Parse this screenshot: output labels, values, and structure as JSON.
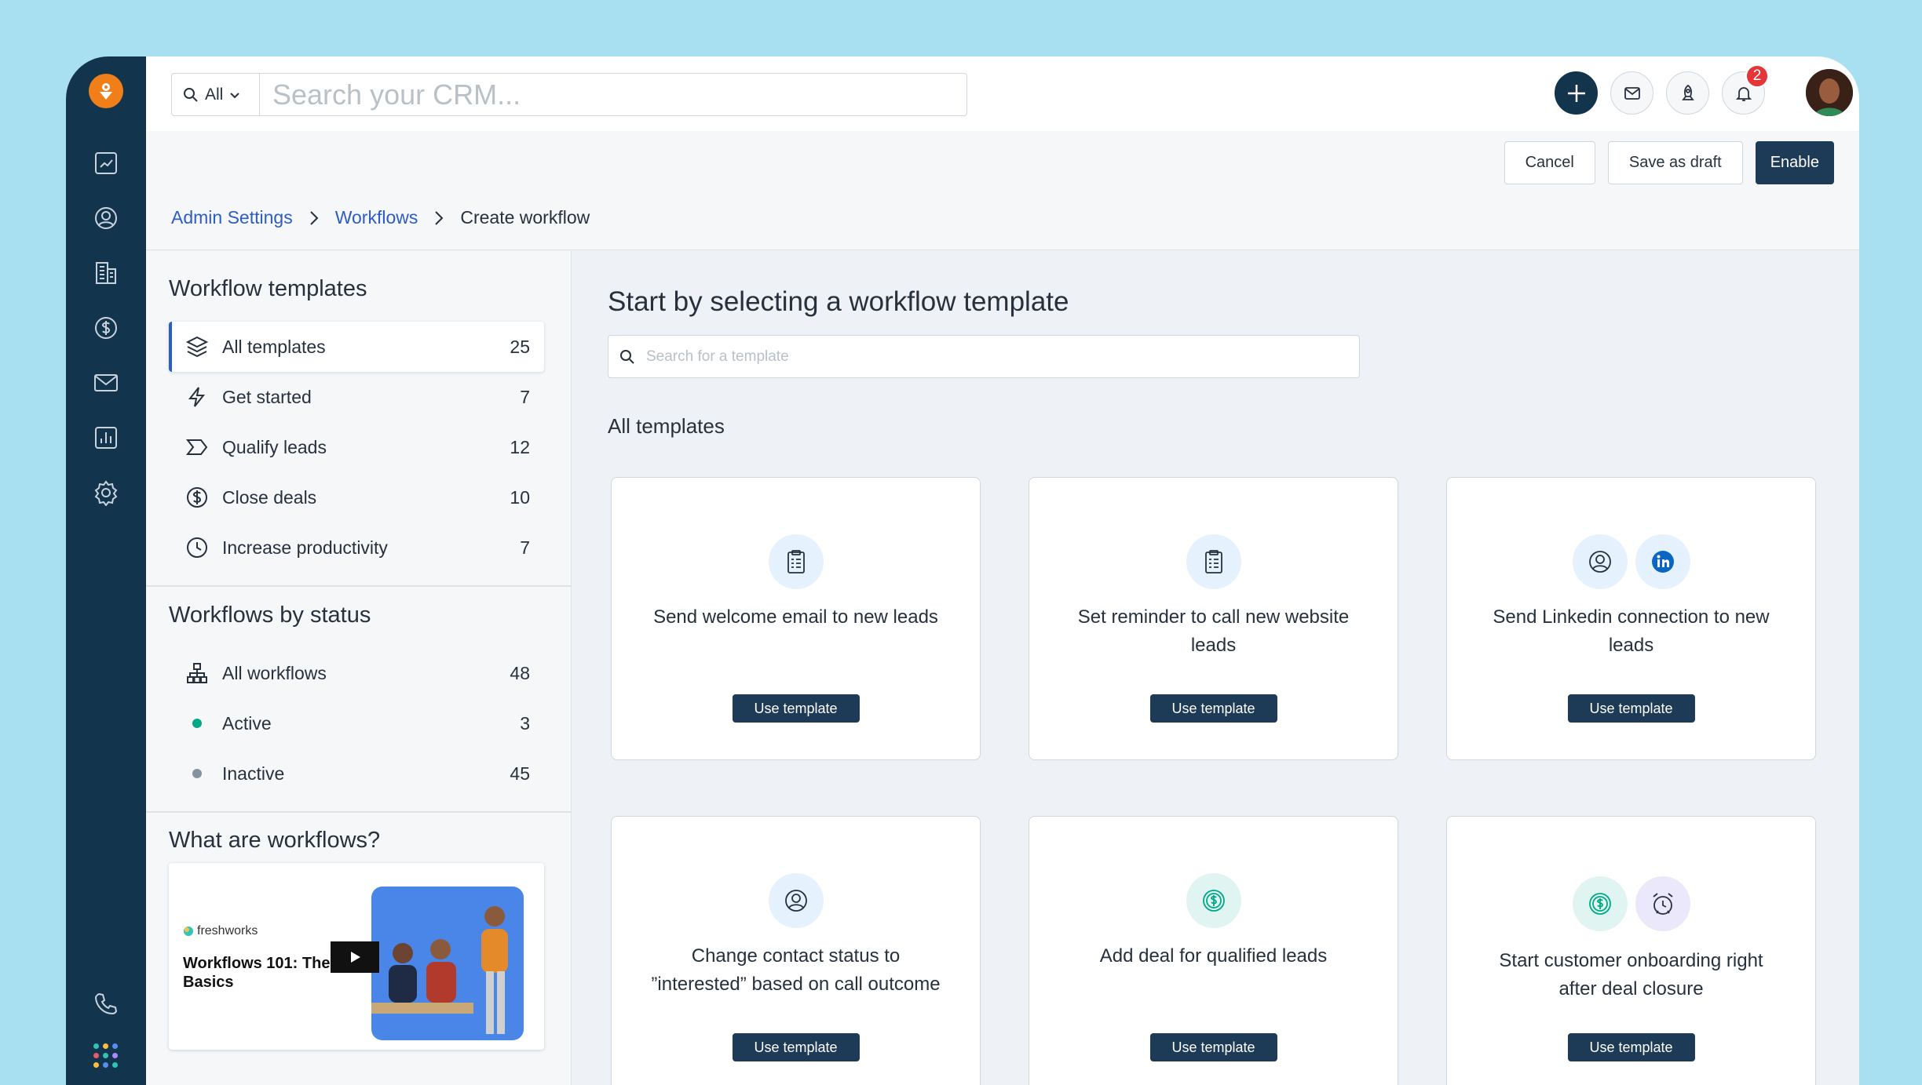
{
  "topbar": {
    "search_scope": "All",
    "search_placeholder": "Search your CRM...",
    "notification_count": "2"
  },
  "breadcrumb": {
    "items": [
      "Admin Settings",
      "Workflows"
    ],
    "current": "Create workflow"
  },
  "actions": {
    "cancel": "Cancel",
    "save_draft": "Save as draft",
    "enable": "Enable"
  },
  "sidebar": {
    "templates_title": "Workflow templates",
    "template_filters": [
      {
        "label": "All templates",
        "count": "25",
        "icon": "layers-icon"
      },
      {
        "label": "Get started",
        "count": "7",
        "icon": "lightning-icon"
      },
      {
        "label": "Qualify leads",
        "count": "12",
        "icon": "chevron-tag-icon"
      },
      {
        "label": "Close deals",
        "count": "10",
        "icon": "dollar-icon"
      },
      {
        "label": "Increase productivity",
        "count": "7",
        "icon": "clock-icon"
      }
    ],
    "status_title": "Workflows by status",
    "status_filters": [
      {
        "label": "All workflows",
        "count": "48",
        "icon": "hierarchy-icon"
      },
      {
        "label": "Active",
        "count": "3",
        "color": "#00a886"
      },
      {
        "label": "Inactive",
        "count": "45",
        "color": "#8692a0"
      }
    ],
    "video_title": "What are workflows?",
    "video": {
      "brand": "freshworks",
      "title": "Workflows 101: The Basics"
    }
  },
  "main": {
    "title": "Start by selecting a workflow template",
    "search_placeholder": "Search for a template",
    "section_label": "All templates",
    "button_label": "Use template",
    "cards": [
      {
        "title": "Send welcome email to new leads",
        "icons": [
          "clipboard-icon"
        ]
      },
      {
        "title": "Set reminder to call new website leads",
        "icons": [
          "clipboard-icon"
        ]
      },
      {
        "title": "Send Linkedin connection to new leads",
        "icons": [
          "contact-icon",
          "linkedin-icon"
        ]
      },
      {
        "title": "Change contact status to ”interested” based on call outcome",
        "icons": [
          "contact-icon"
        ]
      },
      {
        "title": "Add deal for qualified leads",
        "icons": [
          "deal-icon"
        ]
      },
      {
        "title": "Start customer onboarding right after deal closure",
        "icons": [
          "deal-icon",
          "alarm-icon"
        ]
      }
    ]
  },
  "colors": {
    "nav": "#12344d",
    "primary_button": "#1d3a56",
    "link": "#2c5cc5",
    "accent_orange": "#f07f19",
    "background": "#a8dff1"
  }
}
